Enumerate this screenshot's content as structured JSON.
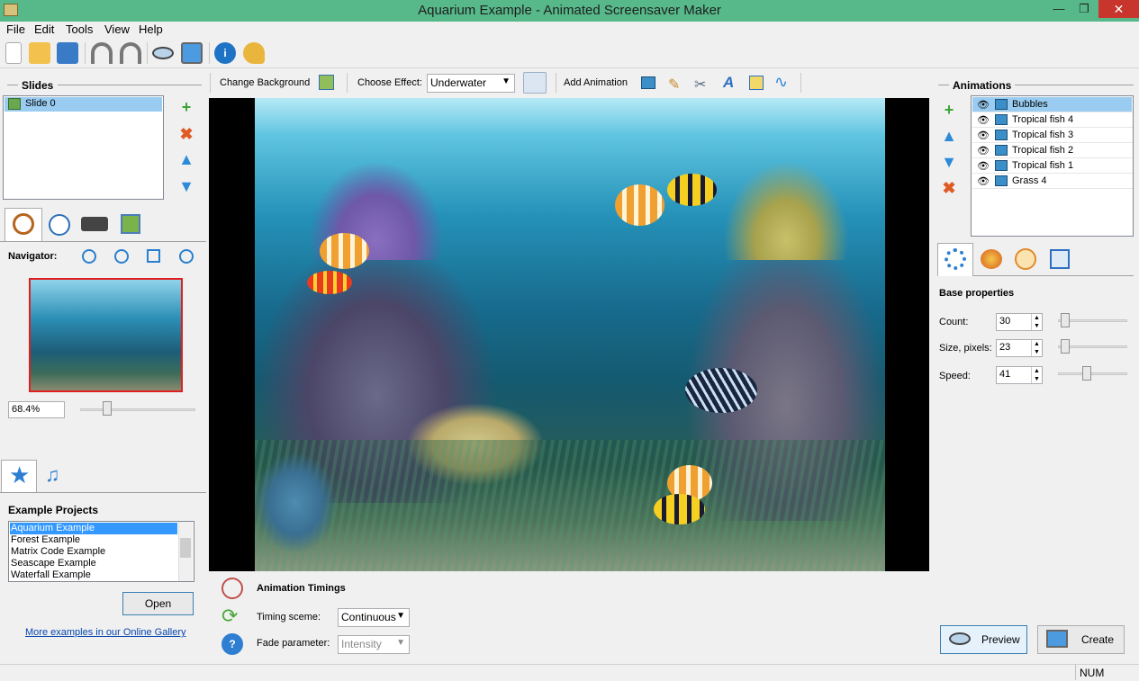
{
  "window": {
    "title": "Aquarium Example - Animated Screensaver Maker",
    "min": "—",
    "max": "❐",
    "close": "✕"
  },
  "menu": [
    "File",
    "Edit",
    "Tools",
    "View",
    "Help"
  ],
  "slides": {
    "header": "Slides",
    "items": [
      "Slide 0"
    ]
  },
  "navigator": {
    "label": "Navigator:",
    "zoom": "68.4%"
  },
  "examples": {
    "header": "Example Projects",
    "items": [
      "Aquarium Example",
      "Forest Example",
      "Matrix Code Example",
      "Seascape Example",
      "Waterfall Example"
    ],
    "open": "Open",
    "gallery_link": "More examples in our Online Gallery"
  },
  "editor_toolbar": {
    "change_bg": "Change Background",
    "choose_effect": "Choose Effect:",
    "effect_value": "Underwater",
    "add_animation": "Add Animation"
  },
  "timings": {
    "header": "Animation Timings",
    "scheme_label": "Timing sceme:",
    "scheme_value": "Continuous",
    "fade_label": "Fade parameter:",
    "fade_value": "Intensity"
  },
  "animations": {
    "header": "Animations",
    "items": [
      "Bubbles",
      "Tropical fish 4",
      "Tropical fish 3",
      "Tropical fish 2",
      "Tropical fish 1",
      "Grass 4"
    ]
  },
  "properties": {
    "header": "Base properties",
    "count_label": "Count:",
    "count_value": "30",
    "count_level": 0.05,
    "size_label": "Size, pixels:",
    "size_value": "23",
    "size_level": 0.05,
    "speed_label": "Speed:",
    "speed_value": "41",
    "speed_level": 0.4
  },
  "buttons": {
    "preview": "Preview",
    "create": "Create"
  },
  "status": {
    "num": "NUM"
  }
}
